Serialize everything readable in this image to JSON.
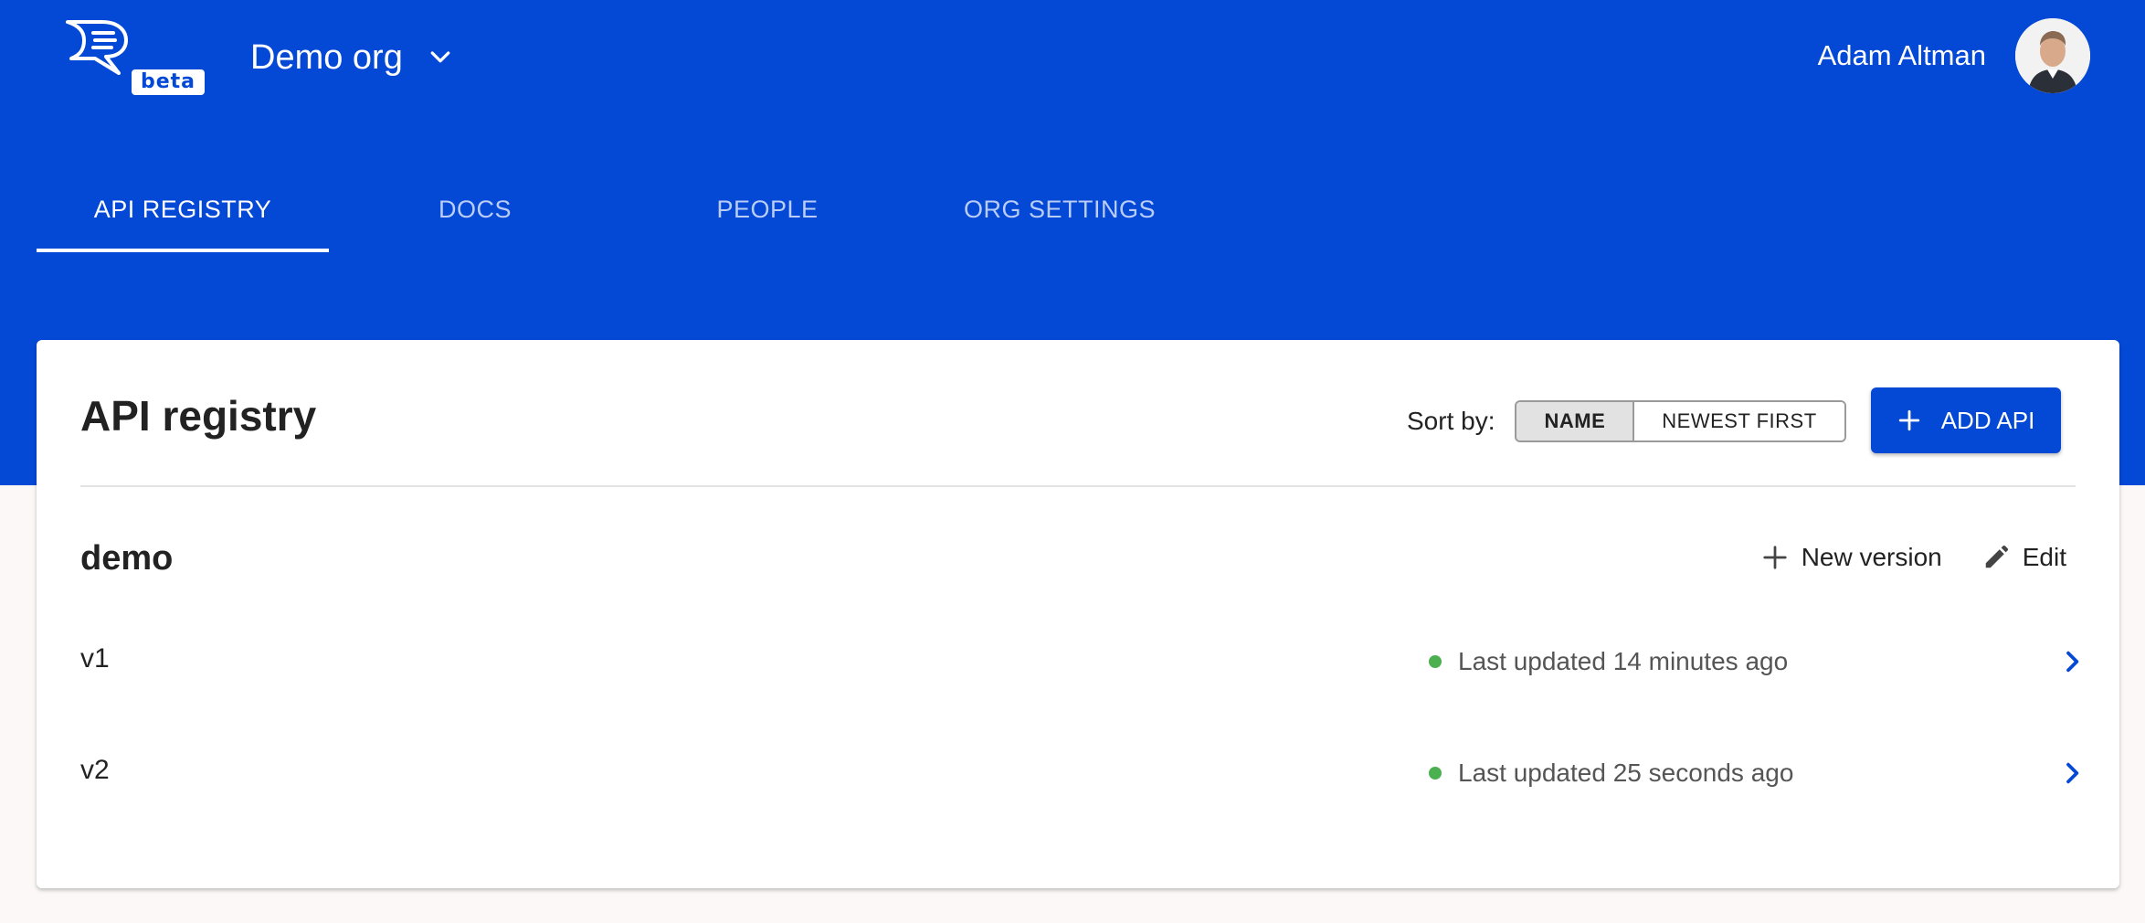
{
  "brand": {
    "badge": "beta",
    "logo_icon": "speech-bubble-logo",
    "primary_color": "#0448d6"
  },
  "org": {
    "name": "Demo org",
    "switch_icon": "chevron-down-icon"
  },
  "user": {
    "name": "Adam Altman",
    "avatar_icon": "user-avatar"
  },
  "tabs": [
    {
      "label": "API REGISTRY",
      "active": true
    },
    {
      "label": "DOCS",
      "active": false
    },
    {
      "label": "PEOPLE",
      "active": false
    },
    {
      "label": "ORG SETTINGS",
      "active": false
    }
  ],
  "registry": {
    "title": "API registry",
    "sort_label": "Sort by:",
    "sort_options": [
      {
        "label": "NAME",
        "selected": true
      },
      {
        "label": "NEWEST FIRST",
        "selected": false
      }
    ],
    "add_button_label": "ADD API",
    "apis": [
      {
        "name": "demo",
        "new_version_label": "New version",
        "edit_label": "Edit",
        "versions": [
          {
            "name": "v1",
            "status": "Last updated 14 minutes ago",
            "status_color": "#4caf50"
          },
          {
            "name": "v2",
            "status": "Last updated 25 seconds ago",
            "status_color": "#4caf50"
          }
        ]
      }
    ]
  }
}
